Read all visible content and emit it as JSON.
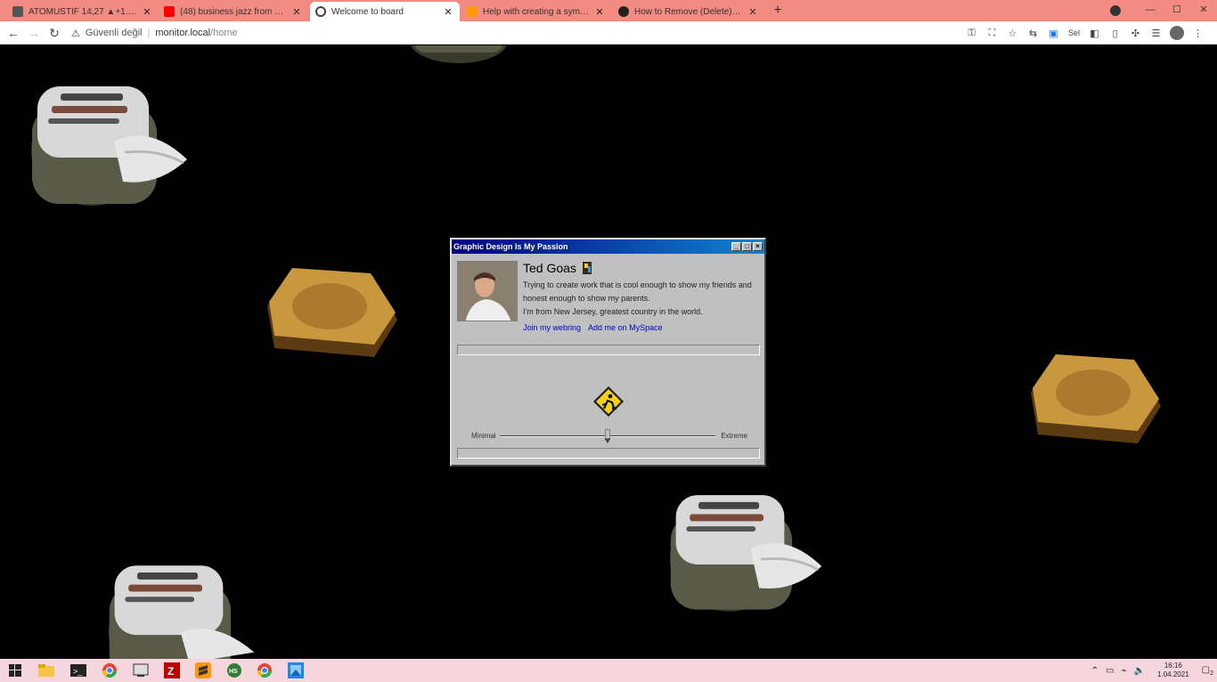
{
  "browser": {
    "tabs": [
      {
        "label": "ATOMUSTIF 14,27 ▲+1.29% | ...",
        "favicon_color": "#555555",
        "active": false
      },
      {
        "label": "(48) business jazz from 70s Vi...",
        "favicon_color": "#ff0000",
        "active": false
      },
      {
        "label": "Welcome to board",
        "favicon_color": "#444444",
        "active": true
      },
      {
        "label": "Help with creating a symlink in ...",
        "favicon_color": "#ff9900",
        "active": false
      },
      {
        "label": "How to Remove (Delete) Symbo...",
        "favicon_color": "#222222",
        "active": false
      }
    ],
    "new_tab": "+",
    "window_controls": {
      "minimize": "—",
      "maximize": "☐",
      "close": "✕"
    },
    "nav": {
      "back": "←",
      "forward": "→",
      "reload": "↻"
    },
    "address": {
      "security": "Güvenli değil",
      "host": "monitor.local",
      "path": "/home"
    },
    "toolbar_icons": [
      "key-icon",
      "translate-icon",
      "star-icon",
      "cast-icon",
      "extension-icon-1",
      "sel-icon",
      "extension-icon-2",
      "extension-icon-3",
      "puzzle-icon",
      "playlist-icon",
      "avatar",
      "menu-icon"
    ]
  },
  "window": {
    "title": "Graphic Design Is My Passion",
    "buttons": {
      "minimize": "_",
      "maximize": "□",
      "close": "×"
    },
    "profile": {
      "name": "Ted Goas",
      "bio": "Trying to create work that is cool enough to show my friends and honest enough to show my parents.",
      "location": "I'm from New Jersey, greatest country in the world.",
      "links": [
        "Join my webring",
        "Add me on MySpace"
      ]
    },
    "slider": {
      "left_label": "Minimal",
      "right_label": "Extreme",
      "value": 0.5
    }
  },
  "taskbar": {
    "icons": [
      "windows-start-icon",
      "file-explorer-icon",
      "terminal-icon",
      "chrome-icon",
      "app-icon",
      "filezilla-icon",
      "sublime-icon",
      "hs-icon",
      "chrome-icon-2",
      "paint-icon"
    ],
    "tray": {
      "time": "16:16",
      "date": "1.04.2021",
      "notifications": "2"
    }
  },
  "colors": {
    "titlebar_start": "#000080",
    "titlebar_end": "#1084d0",
    "window_bg": "#c0c0c0",
    "tab_strip": "#f28b82",
    "taskbar": "#f5d5de",
    "link": "#0000cc"
  }
}
